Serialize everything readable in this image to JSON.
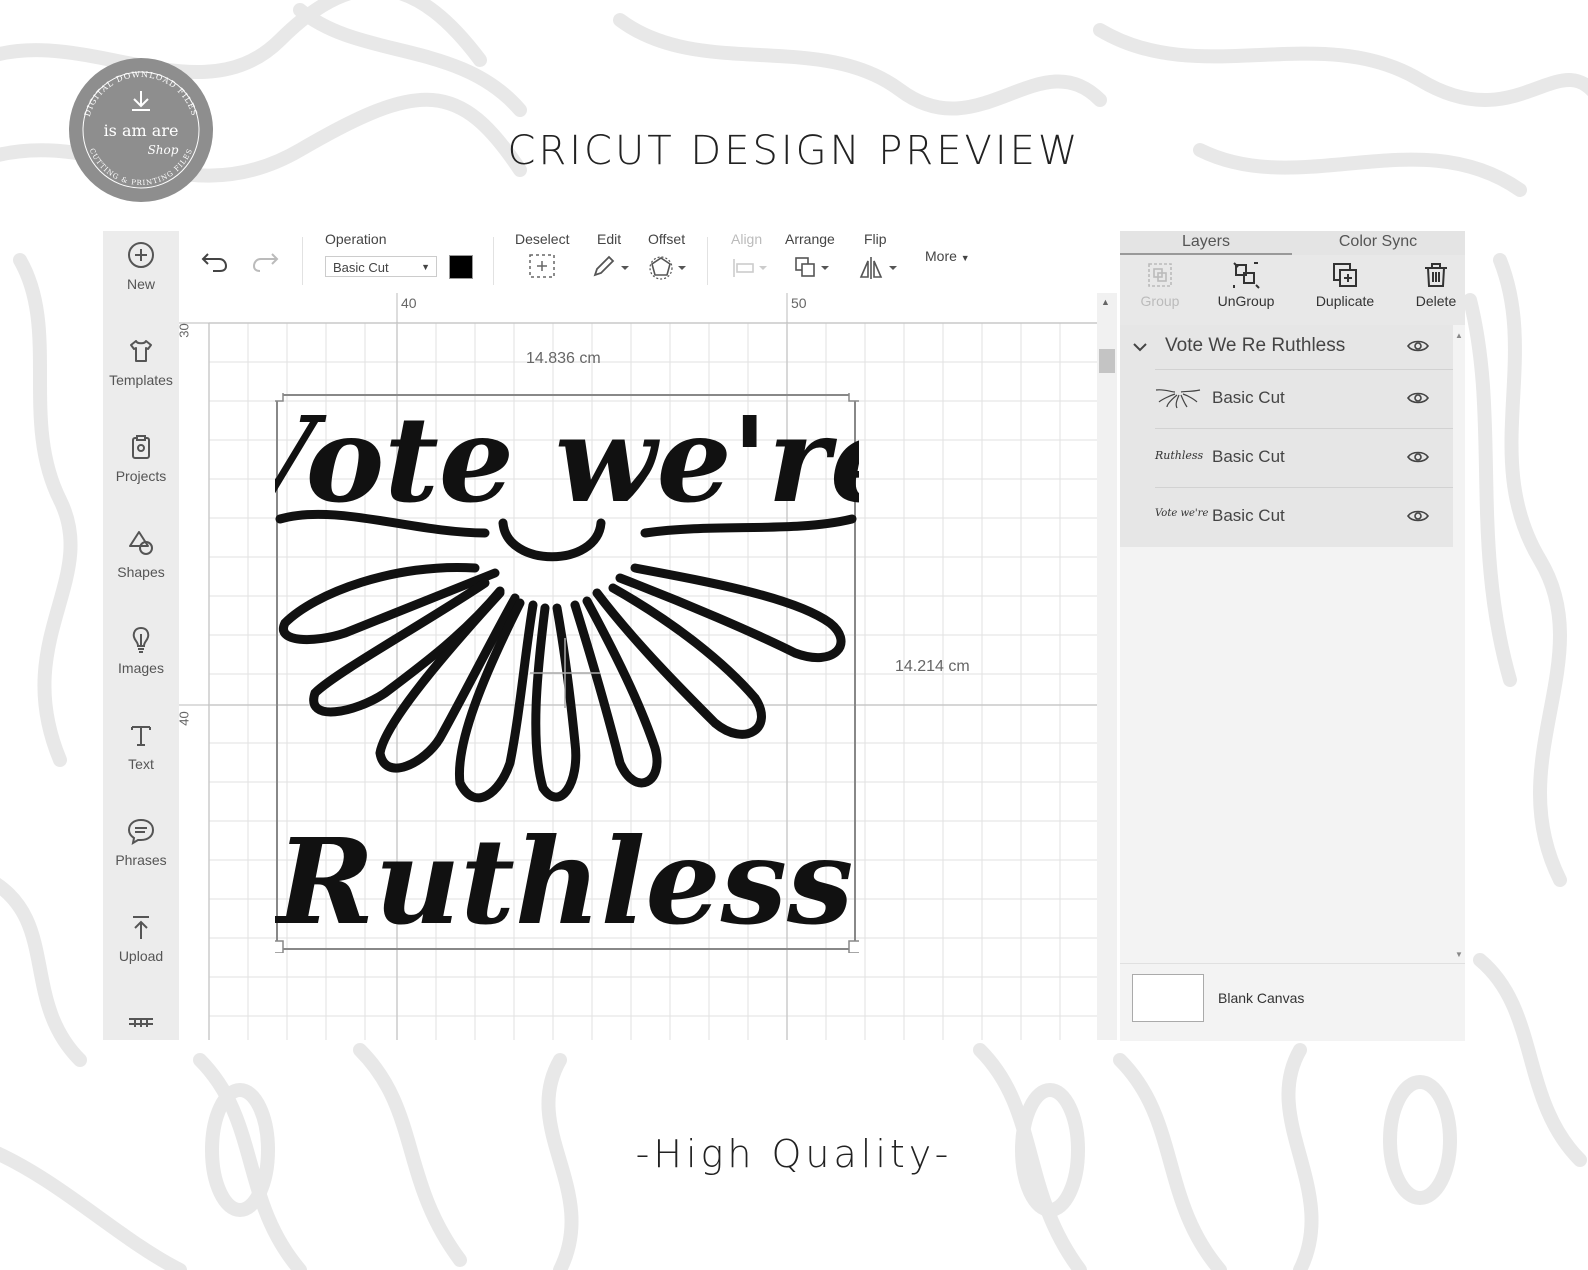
{
  "header": {
    "title": "CRICUT DESIGN PREVIEW",
    "footer": "-High Quality-"
  },
  "logo": {
    "arc_top": "DIGITAL DOWNLOAD FILES",
    "name": "is am are",
    "script": "Shop",
    "arc_bottom": "CUTTING & PRINTING FILES",
    "icon": "download-icon"
  },
  "left_toolbar": {
    "items": [
      {
        "label": "New",
        "icon": "plus-circle-icon"
      },
      {
        "label": "Templates",
        "icon": "tshirt-icon"
      },
      {
        "label": "Projects",
        "icon": "clipboard-icon"
      },
      {
        "label": "Shapes",
        "icon": "shapes-icon"
      },
      {
        "label": "Images",
        "icon": "lightbulb-icon"
      },
      {
        "label": "Text",
        "icon": "text-icon"
      },
      {
        "label": "Phrases",
        "icon": "speech-bubble-icon"
      },
      {
        "label": "Upload",
        "icon": "upload-icon"
      }
    ]
  },
  "top_toolbar": {
    "operation_label": "Operation",
    "operation_value": "Basic Cut",
    "deselect_label": "Deselect",
    "edit_label": "Edit",
    "offset_label": "Offset",
    "align_label": "Align",
    "arrange_label": "Arrange",
    "flip_label": "Flip",
    "more_label": "More",
    "swatch_color": "#000000"
  },
  "canvas": {
    "ruler_top": [
      "40",
      "50"
    ],
    "ruler_left": [
      "30",
      "40"
    ],
    "width_dim": "14.836 cm",
    "height_dim": "14.214 cm",
    "design_line1": "Vote we're",
    "design_line2": "Ruthless"
  },
  "right_panel": {
    "tabs": [
      "Layers",
      "Color Sync"
    ],
    "actions": [
      {
        "label": "Group",
        "icon": "group-icon",
        "disabled": true
      },
      {
        "label": "UnGroup",
        "icon": "ungroup-icon",
        "disabled": false
      },
      {
        "label": "Duplicate",
        "icon": "duplicate-icon",
        "disabled": false
      },
      {
        "label": "Delete",
        "icon": "trash-icon",
        "disabled": false
      }
    ],
    "group_name": "Vote We Re Ruthless",
    "layers": [
      {
        "name": "Basic Cut",
        "thumb": "flower"
      },
      {
        "name": "Basic Cut",
        "thumb": "Ruthless"
      },
      {
        "name": "Basic Cut",
        "thumb": "Vote we're"
      }
    ],
    "blank_canvas_label": "Blank Canvas"
  }
}
